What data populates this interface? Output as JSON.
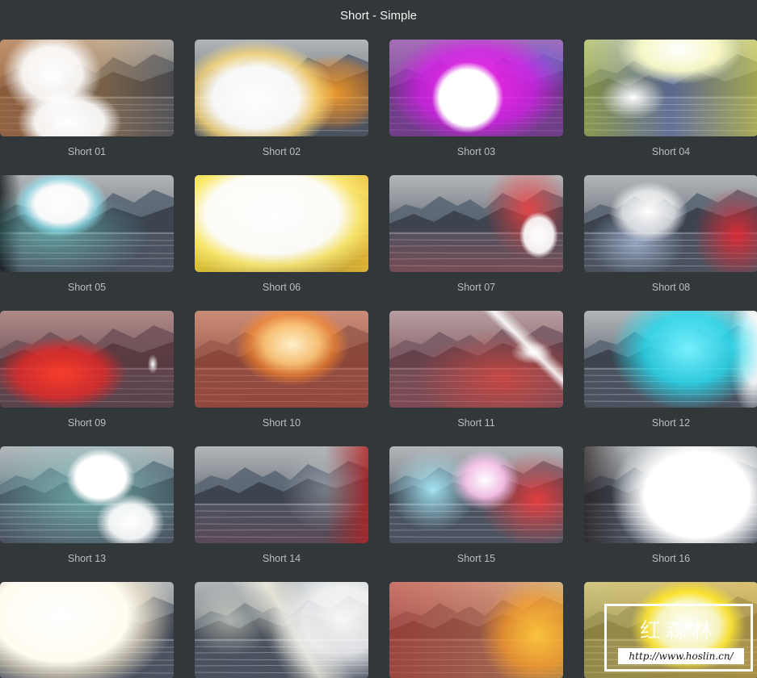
{
  "header": {
    "title": "Short - Simple"
  },
  "presets": [
    {
      "label": "Short 01",
      "flare": "radial-gradient(ellipse 38% 60% at 30% 35%, rgba(255,255,255,1) 0%, rgba(255,255,255,0.9) 45%, rgba(255,255,255,0) 75%), radial-gradient(ellipse 40% 45% at 40% 85%, rgba(255,255,255,1) 0%, rgba(255,255,255,0.9) 50%, rgba(255,255,255,0) 75%), linear-gradient(90deg, rgba(200,110,40,0.55) 0%, rgba(230,150,60,0.35) 60%, rgba(120,90,60,0.2) 100%)"
    },
    {
      "label": "Short 02",
      "flare": "radial-gradient(ellipse 55% 70% at 35% 60%, rgba(255,255,255,1) 0%, rgba(255,255,255,0.95) 45%, rgba(255,220,120,0.8) 65%, rgba(255,180,60,0) 85%), radial-gradient(ellipse 40% 50% at 80% 55%, rgba(255,160,40,0.9) 0%, rgba(255,140,30,0.4) 60%, rgba(255,140,30,0) 80%)"
    },
    {
      "label": "Short 03",
      "flare": "radial-gradient(circle at 45% 60%, rgba(255,255,255,1) 0%, rgba(255,255,255,1) 25%, rgba(255,255,255,0) 32%), radial-gradient(ellipse 60% 70% at 50% 50%, rgba(255,40,240,0.95) 0%, rgba(210,30,230,0.85) 55%, rgba(150,40,180,0.5) 85%), radial-gradient(ellipse 30% 40% at 88% 25%, rgba(90,170,255,0.8) 0%, rgba(90,170,255,0) 80%)"
    },
    {
      "label": "Short 04",
      "flare": "radial-gradient(ellipse 45% 45% at 55% 10%, rgba(255,255,255,1) 0%, rgba(255,255,200,0.9) 50%, rgba(255,255,120,0) 80%), radial-gradient(ellipse 25% 30% at 28% 60%, rgba(255,255,255,1) 0%, rgba(255,255,255,0) 75%), linear-gradient(90deg, rgba(200,220,60,0.5) 0%, rgba(150,170,255,0.35) 50%, rgba(230,230,80,0.6) 100%)"
    },
    {
      "label": "Short 05",
      "flare": "radial-gradient(ellipse 30% 38% at 35% 30%, rgba(255,255,255,1) 0%, rgba(255,255,255,0.95) 50%, rgba(150,240,255,0.6) 70%, rgba(120,220,230,0) 90%), radial-gradient(ellipse 70% 60% at 30% 60%, rgba(120,230,220,0.5) 0%, rgba(120,230,220,0) 80%), linear-gradient(90deg, rgba(0,0,0,0.7) 0%, rgba(0,0,0,0) 12%)"
    },
    {
      "label": "Short 06",
      "flare": "radial-gradient(ellipse 70% 75% at 45% 40%, rgba(255,255,255,1) 0%, rgba(255,255,255,0.95) 55%, rgba(255,240,120,0.8) 72%, rgba(255,210,40,0) 95%), linear-gradient(90deg, rgba(255,220,40,0.8) 0%, rgba(255,200,40,0.5) 50%, rgba(255,200,40,0.8) 100%)"
    },
    {
      "label": "Short 07",
      "flare": "radial-gradient(ellipse 14% 30% at 86% 62%, rgba(255,255,255,1) 0%, rgba(255,255,255,0.9) 60%, rgba(255,255,255,0) 80%), radial-gradient(ellipse 30% 60% at 80% 35%, rgba(255,60,60,0.8) 0%, rgba(255,60,60,0) 85%), linear-gradient(180deg, rgba(0,0,0,0) 50%, rgba(220,60,60,0.3) 100%)"
    },
    {
      "label": "Short 08",
      "flare": "radial-gradient(ellipse 25% 35% at 37% 38%, rgba(255,255,255,1) 0%, rgba(255,255,255,0.7) 60%, rgba(255,255,255,0) 90%), radial-gradient(ellipse 30% 60% at 88% 62%, rgba(230,40,50,0.9) 0%, rgba(230,40,50,0) 85%), radial-gradient(ellipse 35% 45% at 30% 70%, rgba(200,220,255,0.6) 0%, rgba(200,220,255,0) 80%)"
    },
    {
      "label": "Short 09",
      "flare": "radial-gradient(ellipse 45% 45% at 35% 65%, rgba(255,60,40,0.95) 0%, rgba(230,40,40,0.8) 55%, rgba(200,40,40,0) 85%), radial-gradient(ellipse 3% 10% at 88% 55%, rgba(255,255,255,1) 0%, rgba(255,255,255,0) 100%), linear-gradient(180deg, rgba(170,50,40,0.35) 0%, rgba(120,30,30,0.3) 100%)"
    },
    {
      "label": "Short 10",
      "flare": "radial-gradient(ellipse 35% 45% at 56% 35%, rgba(255,240,200,1) 0%, rgba(255,200,120,0.9) 45%, rgba(255,140,40,0.6) 70%, rgba(255,100,30,0) 95%), linear-gradient(180deg, rgba(230,90,40,0.45) 0%, rgba(220,60,30,0.5) 100%)"
    },
    {
      "label": "Short 11",
      "flare": "linear-gradient(45deg, rgba(0,0,0,0) 70%, rgba(255,255,255,0.9) 74%, rgba(255,255,255,0) 80%), radial-gradient(ellipse 12% 12% at 82% 43%, rgba(255,255,255,1) 0%, rgba(255,255,255,0) 100%), radial-gradient(ellipse 60% 60% at 65% 70%, rgba(230,70,60,0.7) 0%, rgba(230,70,60,0) 85%), linear-gradient(180deg, rgba(200,60,60,0.2) 0%, rgba(220,60,60,0.35) 100%)"
    },
    {
      "label": "Short 12",
      "flare": "radial-gradient(ellipse 50% 70% at 60% 40%, rgba(120,240,255,1) 0%, rgba(40,220,240,0.85) 50%, rgba(40,200,230,0) 90%), radial-gradient(ellipse 15% 70% at 98% 40%, rgba(255,255,255,1) 0%, rgba(255,255,255,0.9) 50%, rgba(255,255,255,0) 100%)"
    },
    {
      "label": "Short 13",
      "flare": "radial-gradient(ellipse 22% 33% at 58% 32%, rgba(255,255,255,1) 0%, rgba(255,255,255,1) 65%, rgba(255,255,255,0) 90%), radial-gradient(ellipse 22% 32% at 75% 78%, rgba(255,255,255,1) 0%, rgba(255,255,255,0.9) 55%, rgba(255,255,255,0) 90%), radial-gradient(ellipse 80% 80% at 50% 50%, rgba(140,230,220,0.6) 0%, rgba(140,230,220,0) 85%)"
    },
    {
      "label": "Short 14",
      "flare": "radial-gradient(ellipse 30% 50% at 75% 45%, rgba(255,255,255,0.3) 0%, rgba(255,255,255,0) 85%), linear-gradient(90deg, rgba(0,0,0,0) 75%, rgba(180,30,30,0.8) 100%), linear-gradient(180deg, rgba(0,0,0,0) 50%, rgba(150,40,50,0.2) 100%)"
    },
    {
      "label": "Short 15",
      "flare": "radial-gradient(ellipse 22% 35% at 55% 35%, rgba(255,255,255,1) 0%, rgba(255,200,240,0.9) 50%, rgba(255,160,200,0) 90%), radial-gradient(ellipse 30% 50% at 25% 45%, rgba(170,240,255,0.9) 0%, rgba(170,240,255,0) 85%), radial-gradient(ellipse 40% 60% at 85% 55%, rgba(255,60,60,0.85) 0%, rgba(255,60,60,0) 85%)"
    },
    {
      "label": "Short 16",
      "flare": "radial-gradient(ellipse 55% 80% at 65% 50%, rgba(255,255,255,1) 0%, rgba(255,255,255,1) 55%, rgba(255,255,255,0.6) 70%, rgba(255,255,255,0) 90%), linear-gradient(90deg, rgba(40,30,30,0.7) 0%, rgba(40,30,30,0) 25%)"
    },
    {
      "label": "",
      "flare": "radial-gradient(ellipse 70% 85% at 35% 35%, rgba(255,255,255,1) 0%, rgba(255,252,240,1) 55%, rgba(255,240,210,0.6) 72%, rgba(255,240,200,0) 95%)"
    },
    {
      "label": "",
      "flare": "radial-gradient(ellipse 45% 70% at 85% 40%, rgba(255,255,255,0.95) 0%, rgba(255,255,255,0.8) 50%, rgba(255,255,255,0) 95%), linear-gradient(60deg, rgba(255,255,255,0) 40%, rgba(255,250,230,0.7) 55%, rgba(255,255,255,0) 70%), radial-gradient(ellipse 30% 40% at 20% 40%, rgba(255,255,230,0.5) 0%, rgba(255,255,230,0) 90%)"
    },
    {
      "label": "",
      "flare": "radial-gradient(ellipse 35% 60% at 85% 55%, rgba(255,200,60,0.95) 0%, rgba(255,160,40,0.7) 55%, rgba(255,140,40,0) 95%), linear-gradient(90deg, rgba(220,60,40,0.55) 0%, rgba(240,110,60,0.5) 60%, rgba(255,180,60,0.5) 100%)"
    },
    {
      "label": "",
      "flare": "radial-gradient(ellipse 35% 50% at 60% 45%, rgba(255,255,255,1) 0%, rgba(255,255,200,0.9) 50%, rgba(255,230,40,0.9) 70%, rgba(255,220,40,0) 95%), linear-gradient(90deg, rgba(255,220,40,0.4) 0%, rgba(255,200,40,0.5) 100%)"
    }
  ],
  "watermark": {
    "logo": "红森林",
    "url": "http://www.hoslin.cn/"
  }
}
